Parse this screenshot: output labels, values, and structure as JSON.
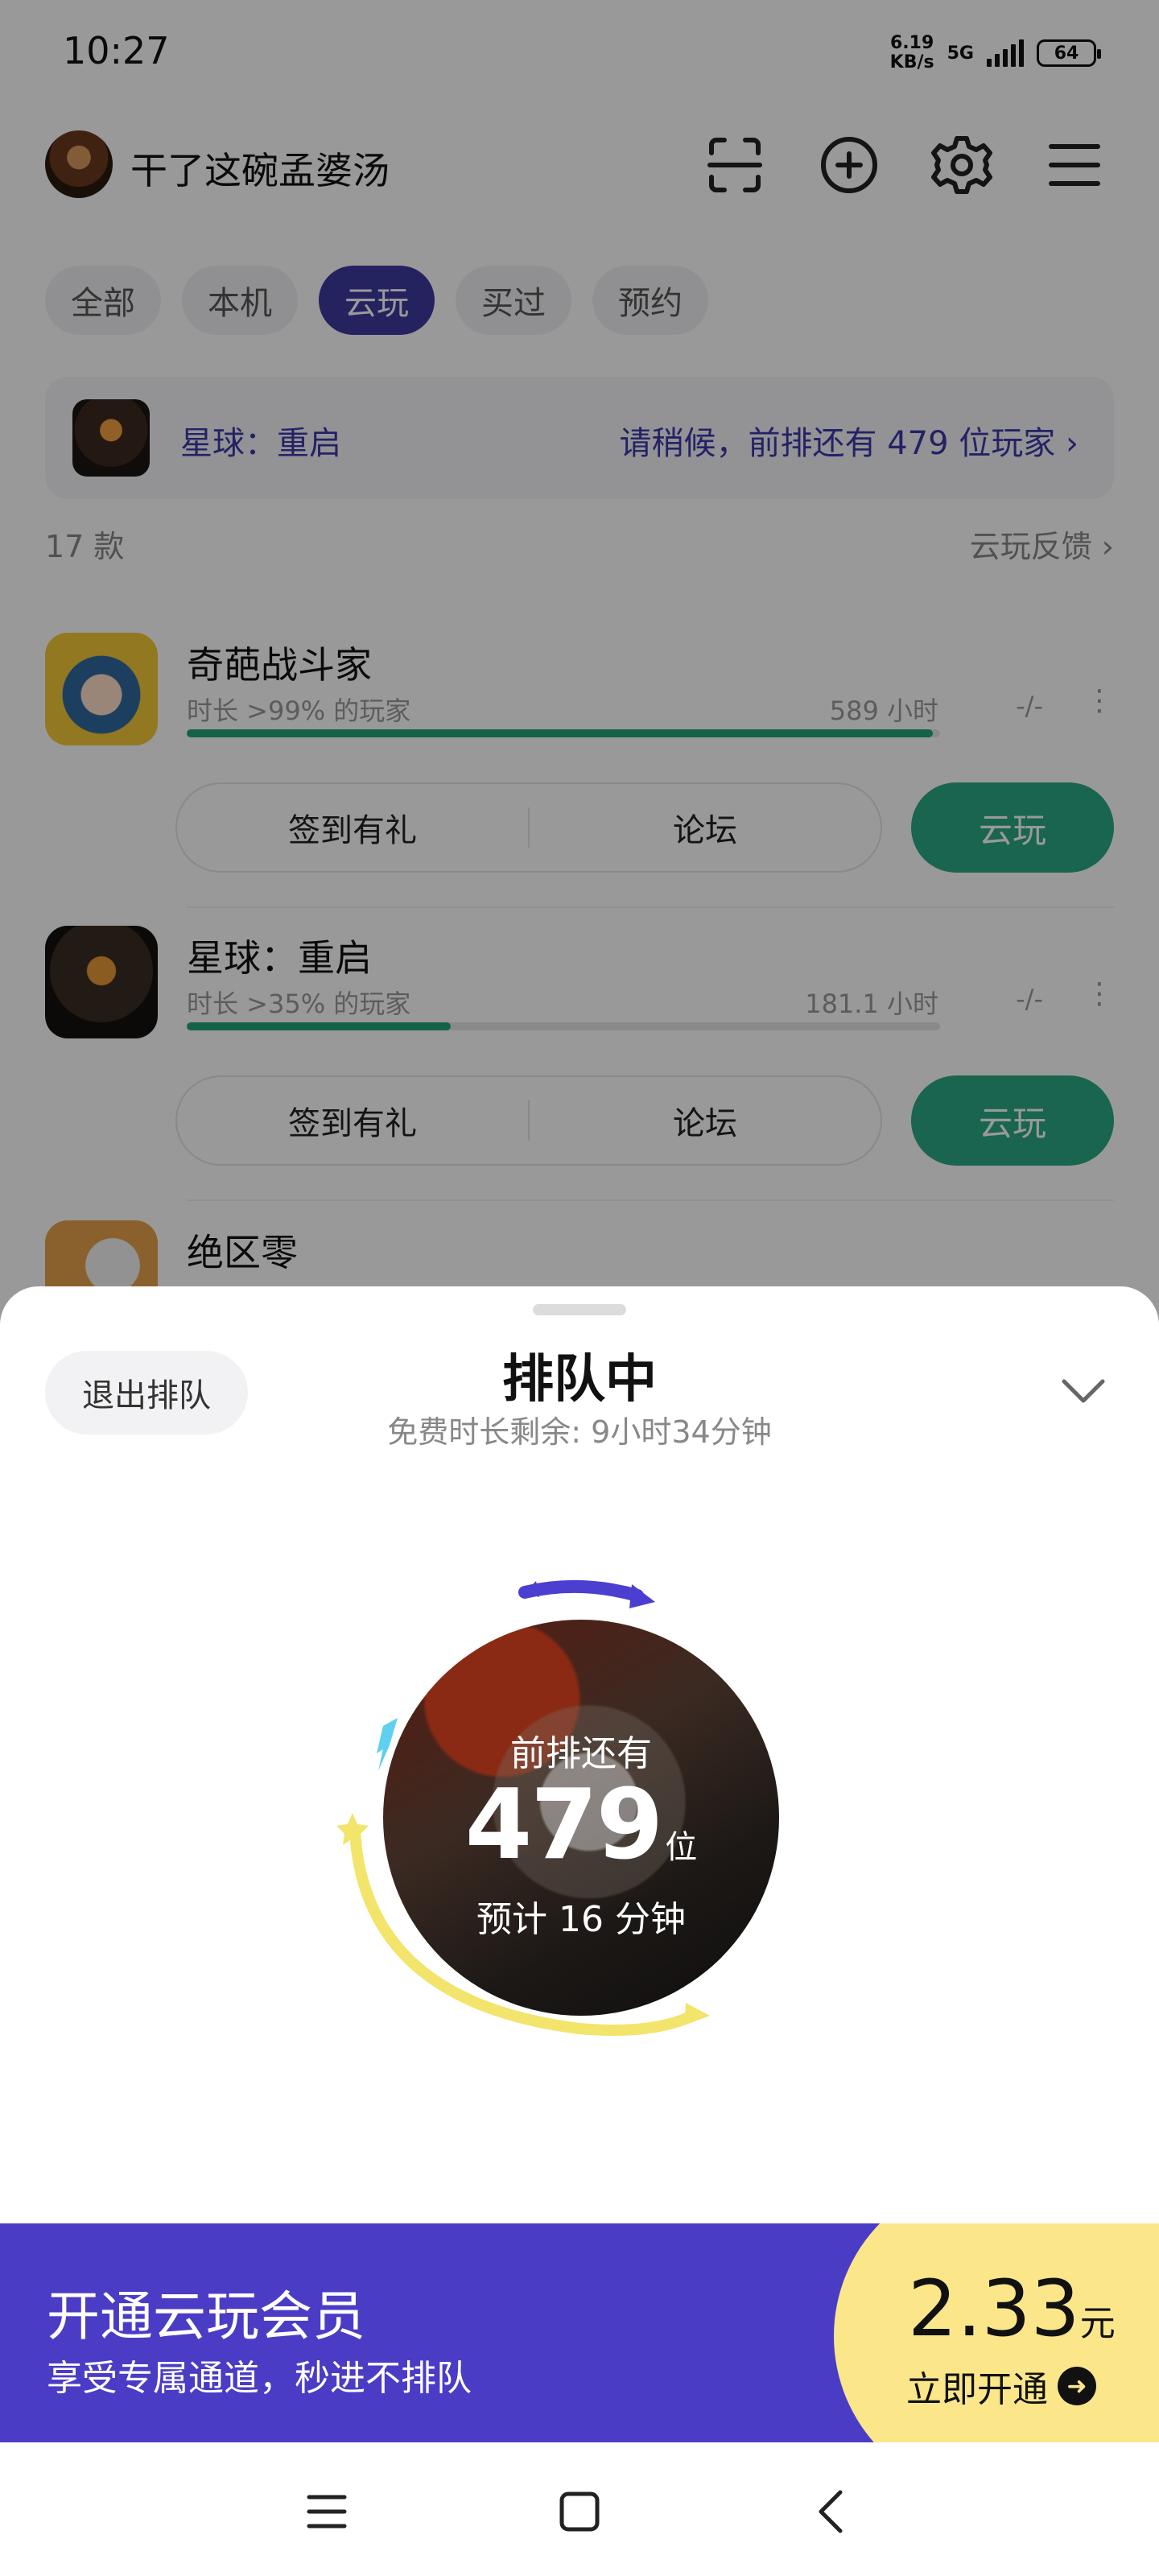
{
  "status_bar": {
    "time": "10:27",
    "net_speed_value": "6.19",
    "net_speed_unit": "KB/s",
    "network": "5G",
    "battery": "64"
  },
  "header": {
    "username": "干了这碗孟婆汤",
    "icons": [
      "scan-icon",
      "add-icon",
      "settings-icon",
      "menu-icon"
    ]
  },
  "tabs": [
    {
      "label": "全部",
      "active": false
    },
    {
      "label": "本机",
      "active": false
    },
    {
      "label": "云玩",
      "active": true
    },
    {
      "label": "买过",
      "active": false
    },
    {
      "label": "预约",
      "active": false
    }
  ],
  "queue_banner": {
    "game": "星球：重启",
    "message": "请稍候，前排还有 479 位玩家"
  },
  "list": {
    "count": "17 款",
    "feedback": "云玩反馈"
  },
  "games": [
    {
      "name": "奇葩战斗家",
      "stat": "时长 >99% 的玩家",
      "hours": "589 小时",
      "rank": "-/-",
      "progress": 0.99,
      "sign_in": "签到有礼",
      "forum": "论坛",
      "cloud_play": "云玩"
    },
    {
      "name": "星球：重启",
      "stat": "时长 >35% 的玩家",
      "hours": "181.1 小时",
      "rank": "-/-",
      "progress": 0.35,
      "sign_in": "签到有礼",
      "forum": "论坛",
      "cloud_play": "云玩"
    },
    {
      "name": "绝区零"
    }
  ],
  "sheet": {
    "exit_button": "退出排队",
    "title": "排队中",
    "subtitle": "免费时长剩余: 9小时34分钟",
    "queue": {
      "label": "前排还有",
      "number": "479",
      "unit": "位",
      "eta": "预计 16 分钟"
    },
    "vip": {
      "title": "开通云玩会员",
      "desc": "享受专属通道，秒进不排队",
      "price": "2.33",
      "price_unit": "元",
      "cta": "立即开通"
    }
  },
  "colors": {
    "brand_purple": "#4b3cc6",
    "cloud_green": "#2aa886",
    "vip_yellow": "#fbe78a",
    "arc_blue": "#4a3fd0",
    "arc_yellow": "#f3e46b",
    "bolt_cyan": "#5fd0f0"
  }
}
